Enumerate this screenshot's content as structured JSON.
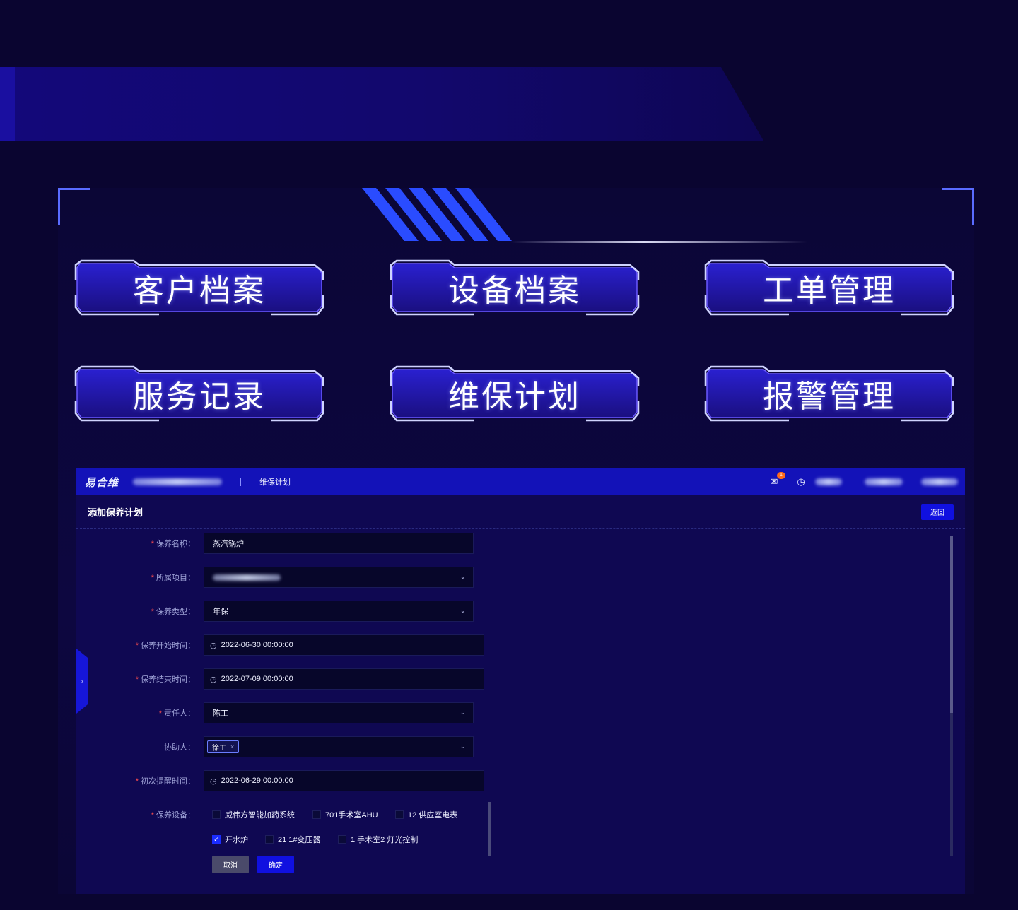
{
  "nav": [
    {
      "label": "客户档案"
    },
    {
      "label": "设备档案"
    },
    {
      "label": "工单管理"
    },
    {
      "label": "服务记录"
    },
    {
      "label": "维保计划"
    },
    {
      "label": "报警管理"
    }
  ],
  "app": {
    "logo": "易合维",
    "breadcrumb": "维保计划",
    "notification_count": "1",
    "page_title": "添加保养计划",
    "back_label": "返回"
  },
  "form": {
    "name_label": "保养名称：",
    "name_value": "蒸汽锅炉",
    "project_label": "所属项目：",
    "type_label": "保养类型：",
    "type_value": "年保",
    "start_label": "保养开始时间：",
    "start_value": "2022-06-30 00:00:00",
    "end_label": "保养结束时间：",
    "end_value": "2022-07-09 00:00:00",
    "owner_label": "责任人：",
    "owner_value": "陈工",
    "assistant_label": "协助人：",
    "assistant_tag": "徐工",
    "remind_label": "初次提醒时间：",
    "remind_value": "2022-06-29 00:00:00",
    "devices_label": "保养设备：",
    "devices": [
      {
        "label": "威伟方智能加药系统",
        "checked": false
      },
      {
        "label": "701手术室AHU",
        "checked": false
      },
      {
        "label": "12 供应室电表",
        "checked": false
      },
      {
        "label": "开水炉",
        "checked": true
      },
      {
        "label": "21 1#变压器",
        "checked": false
      },
      {
        "label": "1 手术室2 灯光控制",
        "checked": false
      }
    ],
    "cancel_label": "取消",
    "ok_label": "确定"
  },
  "colors": {
    "background": "#0a0530",
    "accent": "#1010e0",
    "frame_corner": "#5a6cff",
    "stripes": "#2a4cff",
    "required": "#ff4d4f",
    "badge": "#ff6a1a"
  }
}
